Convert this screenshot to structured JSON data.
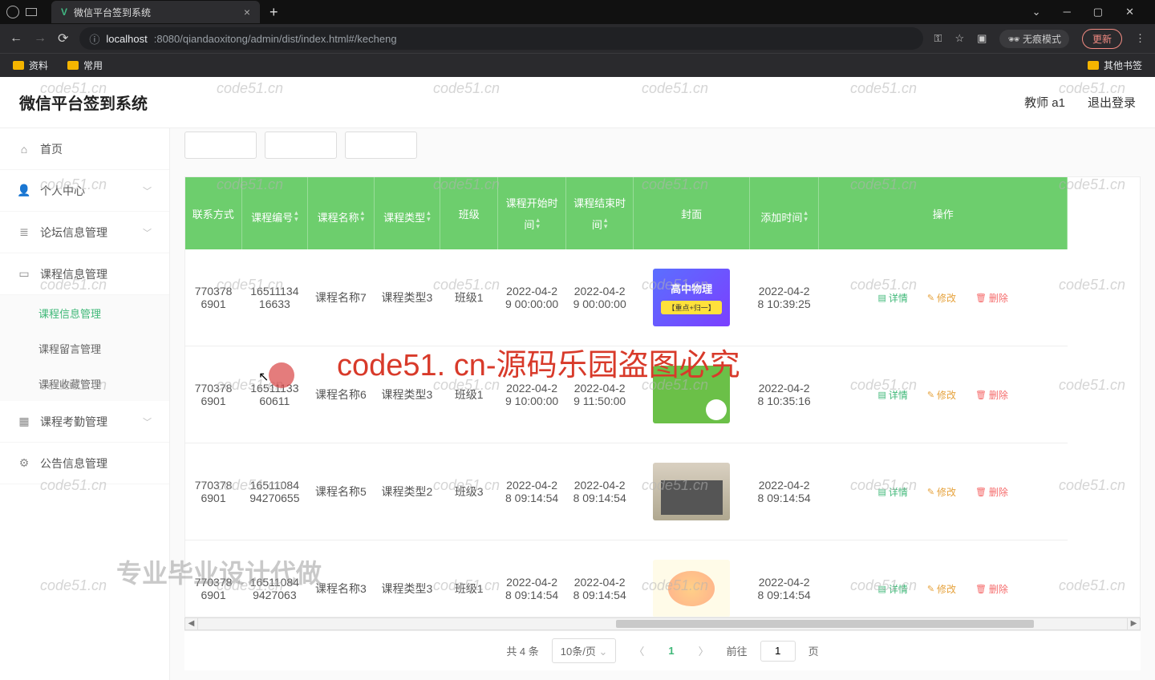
{
  "browser": {
    "tab_title": "微信平台签到系统",
    "url_host": "localhost",
    "url_path": ":8080/qiandaoxitong/admin/dist/index.html#/kecheng",
    "incognito": "无痕模式",
    "update": "更新",
    "bookmarks": {
      "ziliao": "资料",
      "changyong": "常用",
      "other": "其他书签"
    }
  },
  "app": {
    "title": "微信平台签到系统",
    "user": "教师 a1",
    "logout": "退出登录"
  },
  "sidebar": {
    "home": "首页",
    "personal": "个人中心",
    "forum": "论坛信息管理",
    "course": "课程信息管理",
    "course_sub1": "课程信息管理",
    "course_sub2": "课程留言管理",
    "course_sub3": "课程收藏管理",
    "attendance": "课程考勤管理",
    "notice": "公告信息管理"
  },
  "table": {
    "headers": {
      "contact": "联系方式",
      "course_no": "课程编号",
      "course_name": "课程名称",
      "course_type": "课程类型",
      "class": "班级",
      "start_time": "课程开始时间",
      "end_time": "课程结束时间",
      "cover": "封面",
      "add_time": "添加时间",
      "operate": "操作"
    },
    "actions": {
      "detail": "详情",
      "edit": "修改",
      "del": "删除"
    },
    "rows": [
      {
        "contact": "7703786901",
        "no": "1651113416633",
        "name": "课程名称7",
        "type": "课程类型3",
        "class": "班级1",
        "start": "2022-04-29 00:00:00",
        "end": "2022-04-29 00:00:00",
        "cover_text": "高中物理",
        "add": "2022-04-28 10:39:25"
      },
      {
        "contact": "7703786901",
        "no": "1651113360611",
        "name": "课程名称6",
        "type": "课程类型3",
        "class": "班级1",
        "start": "2022-04-29 10:00:00",
        "end": "2022-04-29 11:50:00",
        "cover_text": "",
        "add": "2022-04-28 10:35:16"
      },
      {
        "contact": "7703786901",
        "no": "1651108494270655",
        "name": "课程名称5",
        "type": "课程类型2",
        "class": "班级3",
        "start": "2022-04-28 09:14:54",
        "end": "2022-04-28 09:14:54",
        "cover_text": "",
        "add": "2022-04-28 09:14:54"
      },
      {
        "contact": "7703786901",
        "no": "165110849427063",
        "name": "课程名称3",
        "type": "课程类型3",
        "class": "班级1",
        "start": "2022-04-28 09:14:54",
        "end": "2022-04-28 09:14:54",
        "cover_text": "",
        "add": "2022-04-28 09:14:54"
      }
    ]
  },
  "pagination": {
    "total_label": "共 4 条",
    "per_page": "10条/页",
    "current": "1",
    "goto_label": "前往",
    "goto_value": "1",
    "page_suffix": "页"
  },
  "watermarks": {
    "domain": "code51.cn",
    "red": "code51. cn-源码乐园盗图必究",
    "ghost": "专业毕业设计代做"
  },
  "thumb_tag": "【重点+归一】"
}
